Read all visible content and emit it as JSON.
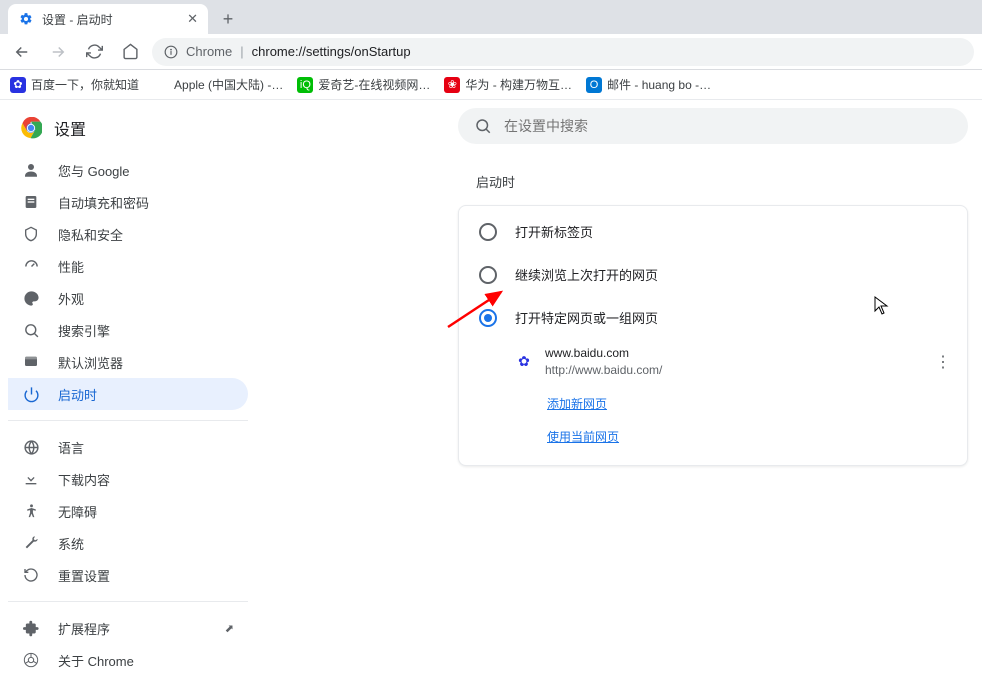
{
  "tab": {
    "title": "设置 - 启动时"
  },
  "omnibox": {
    "chip": "Chrome",
    "url": "chrome://settings/onStartup"
  },
  "bookmarks": [
    {
      "label": "百度一下，你就知道",
      "color": "#2932e1",
      "glyph": "✿"
    },
    {
      "label": "Apple (中国大陆) -…",
      "color": "#000000",
      "glyph": ""
    },
    {
      "label": "爱奇艺-在线视频网…",
      "color": "#00be06",
      "glyph": "iQ"
    },
    {
      "label": "华为 - 构建万物互…",
      "color": "#e60012",
      "glyph": "❀"
    },
    {
      "label": "邮件 - huang bo -…",
      "color": "#0078d4",
      "glyph": "O"
    }
  ],
  "settings_title": "设置",
  "search_placeholder": "在设置中搜索",
  "sidebar": {
    "items": [
      {
        "label": "您与 Google",
        "icon": "person"
      },
      {
        "label": "自动填充和密码",
        "icon": "autofill"
      },
      {
        "label": "隐私和安全",
        "icon": "shield"
      },
      {
        "label": "性能",
        "icon": "speed"
      },
      {
        "label": "外观",
        "icon": "palette"
      },
      {
        "label": "搜索引擎",
        "icon": "search"
      },
      {
        "label": "默认浏览器",
        "icon": "browser"
      },
      {
        "label": "启动时",
        "icon": "power"
      }
    ],
    "items2": [
      {
        "label": "语言",
        "icon": "globe"
      },
      {
        "label": "下载内容",
        "icon": "download"
      },
      {
        "label": "无障碍",
        "icon": "accessibility"
      },
      {
        "label": "系统",
        "icon": "wrench"
      },
      {
        "label": "重置设置",
        "icon": "reset"
      }
    ],
    "items3": [
      {
        "label": "扩展程序",
        "icon": "extension",
        "external": true
      },
      {
        "label": "关于 Chrome",
        "icon": "chrome"
      }
    ]
  },
  "section": {
    "heading": "启动时",
    "options": [
      {
        "label": "打开新标签页",
        "checked": false
      },
      {
        "label": "继续浏览上次打开的网页",
        "checked": false
      },
      {
        "label": "打开特定网页或一组网页",
        "checked": true
      }
    ],
    "startup_page": {
      "title": "www.baidu.com",
      "url": "http://www.baidu.com/"
    },
    "add_page": "添加新网页",
    "use_current": "使用当前网页"
  }
}
